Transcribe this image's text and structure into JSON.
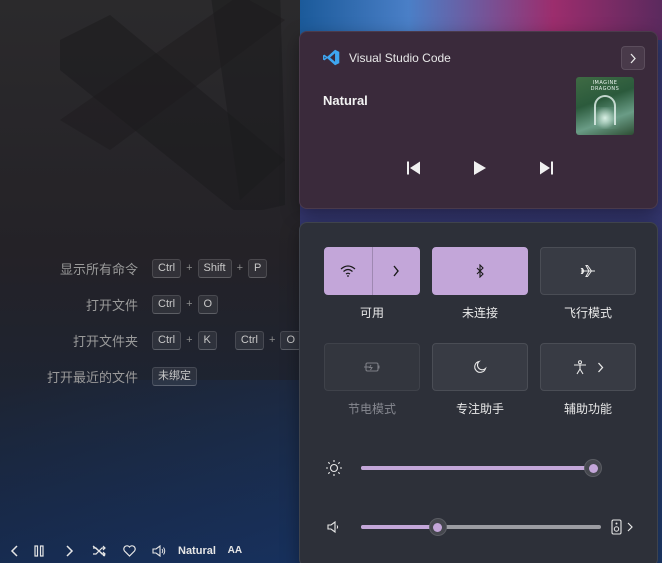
{
  "editor": {
    "shortcuts": [
      {
        "label": "显示所有命令",
        "keys": [
          [
            "Ctrl",
            "Shift",
            "P"
          ]
        ]
      },
      {
        "label": "打开文件",
        "keys": [
          [
            "Ctrl",
            "O"
          ]
        ]
      },
      {
        "label": "打开文件夹",
        "keys": [
          [
            "Ctrl",
            "K"
          ],
          [
            "Ctrl",
            "O"
          ]
        ]
      },
      {
        "label": "打开最近的文件",
        "keys": [
          [
            "未绑定"
          ]
        ]
      }
    ]
  },
  "statusbar": {
    "track_name": "Natural",
    "font_toggle": "AA"
  },
  "media": {
    "app_name": "Visual Studio Code",
    "track_title": "Natural",
    "album_art_text": "IMAGINE DRAGONS",
    "app_icon_color": "#3ea6f0"
  },
  "quick_settings": {
    "tiles": [
      {
        "id": "wifi",
        "label": "可用",
        "state": "on",
        "icon": "wifi-icon"
      },
      {
        "id": "bluetooth",
        "label": "未连接",
        "state": "on",
        "icon": "bluetooth-icon"
      },
      {
        "id": "airplane",
        "label": "飞行模式",
        "state": "off",
        "icon": "airplane-icon"
      },
      {
        "id": "battery-saver",
        "label": "节电模式",
        "state": "disabled",
        "icon": "battery-saver-icon"
      },
      {
        "id": "focus-assist",
        "label": "专注助手",
        "state": "off",
        "icon": "moon-icon"
      },
      {
        "id": "accessibility",
        "label": "辅助功能",
        "state": "off",
        "icon": "accessibility-icon"
      }
    ],
    "brightness": 1.0,
    "volume": 0.32,
    "accent_color": "#c3a6d9"
  }
}
